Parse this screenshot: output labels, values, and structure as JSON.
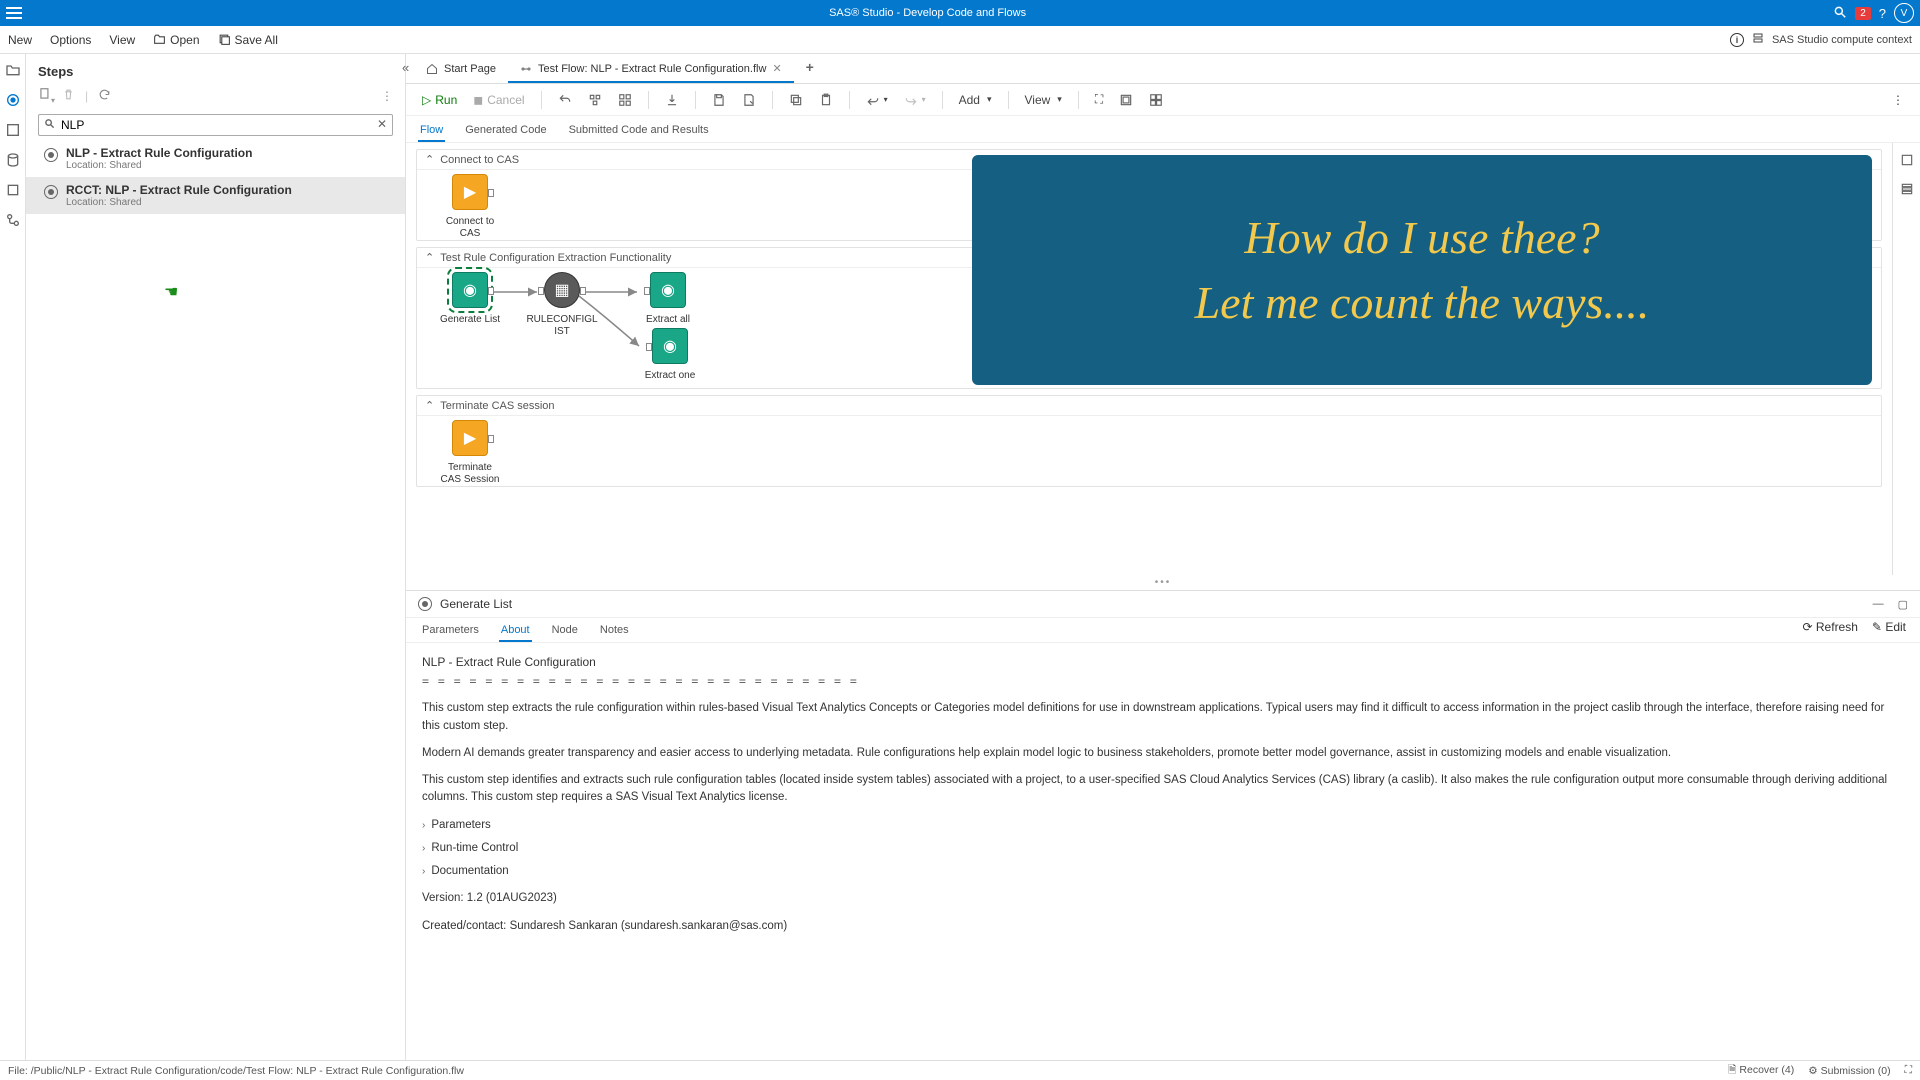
{
  "titlebar": {
    "title": "SAS® Studio - Develop Code and Flows",
    "notif_count": "2",
    "avatar": "V"
  },
  "menubar": {
    "new": "New",
    "options": "Options",
    "view": "View",
    "open": "Open",
    "saveall": "Save All",
    "context": "SAS Studio compute context"
  },
  "steps": {
    "title": "Steps",
    "search": "NLP",
    "items": [
      {
        "name": "NLP - Extract Rule Configuration",
        "loc": "Location: Shared"
      },
      {
        "name": "RCCT: NLP - Extract Rule Configuration",
        "loc": "Location: Shared"
      }
    ]
  },
  "tabs": {
    "start": "Start Page",
    "flow": "Test Flow: NLP - Extract Rule Configuration.flw"
  },
  "toolbar": {
    "run": "Run",
    "cancel": "Cancel",
    "add": "Add",
    "view": "View"
  },
  "subtabs": {
    "flow": "Flow",
    "gen": "Generated Code",
    "sub": "Submitted Code and Results"
  },
  "sections": {
    "s1": "Connect to CAS",
    "s2": "Test Rule Configuration Extraction Functionality",
    "s3": "Terminate CAS session"
  },
  "nodes": {
    "connect": "Connect to\nCAS",
    "generate": "Generate List",
    "ruleconfig": "RULECONFIGL\nIST",
    "extractall": "Extract all",
    "extractone": "Extract one",
    "terminate": "Terminate\nCAS Session"
  },
  "callout": {
    "line1": "How do I use thee?",
    "line2": "Let me count the ways...."
  },
  "details": {
    "title": "Generate List",
    "tabs": {
      "param": "Parameters",
      "about": "About",
      "node": "Node",
      "notes": "Notes"
    },
    "refresh": "Refresh",
    "edit": "Edit",
    "heading": "NLP - Extract Rule Configuration",
    "p1": "This custom step extracts the rule configuration within rules-based Visual Text Analytics Concepts or Categories model definitions for use in downstream applications.  Typical users may find it difficult to access information in the project caslib through the interface, therefore raising need for this custom step.",
    "p2": "Modern AI demands greater transparency and easier access to underlying metadata.  Rule configurations help explain model logic to business stakeholders, promote better model governance, assist in customizing models and enable  visualization.",
    "p3": "This custom step identifies and extracts such rule configuration tables (located inside system tables) associated with a project, to a user-specified SAS Cloud Analytics Services (CAS) library (a caslib).  It also makes the rule configuration output more consumable through deriving additional columns.  This custom step  requires a SAS Visual Text Analytics license.",
    "exp1": "Parameters",
    "exp2": "Run-time Control",
    "exp3": "Documentation",
    "version": "Version: 1.2  (01AUG2023)",
    "contact": "Created/contact: Sundaresh Sankaran (sundaresh.sankaran@sas.com)"
  },
  "statusbar": {
    "path": "File: /Public/NLP - Extract Rule Configuration/code/Test Flow: NLP - Extract Rule Configuration.flw",
    "recover": "Recover (4)",
    "submission": "Submission (0)"
  }
}
